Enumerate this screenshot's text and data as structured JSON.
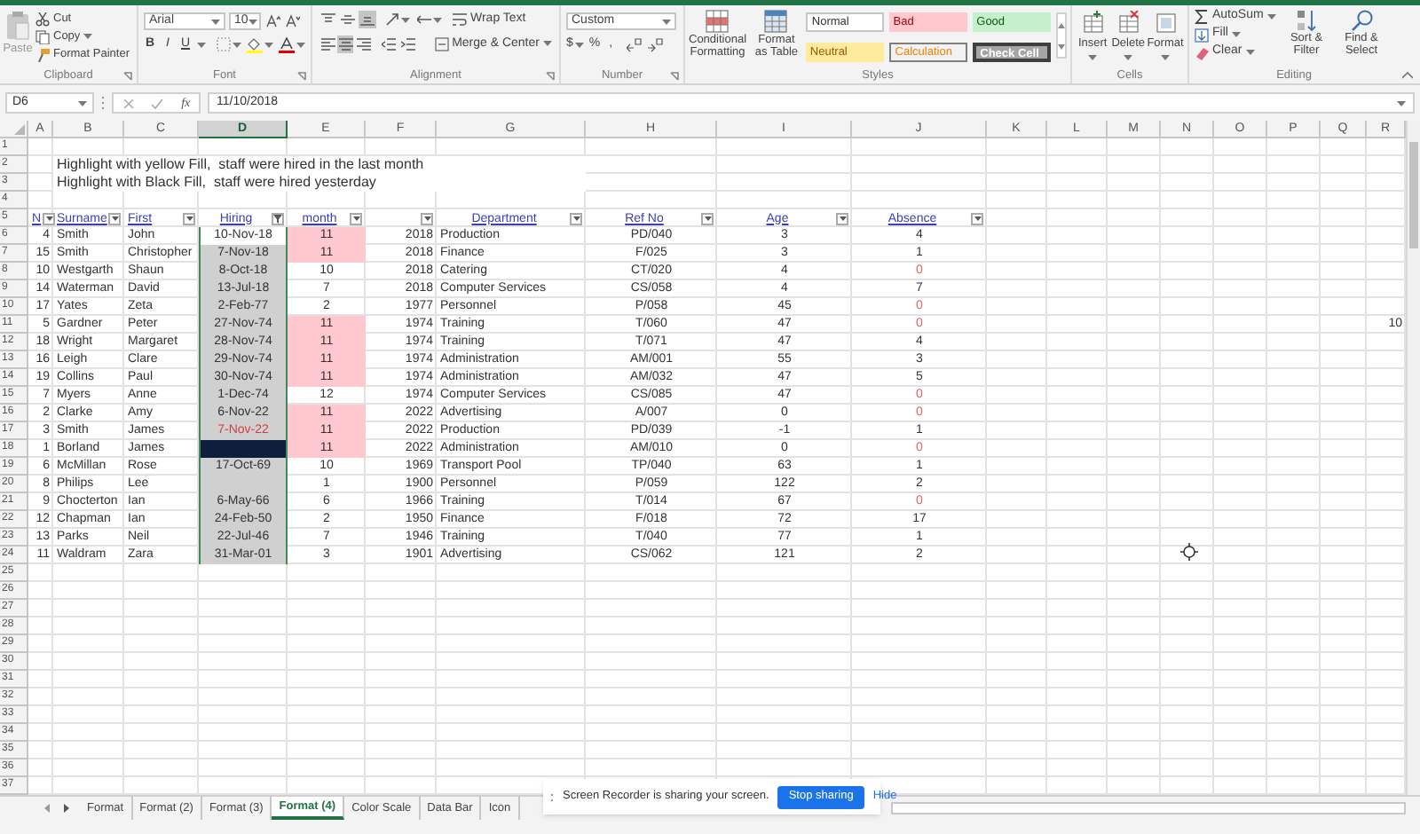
{
  "ribbon": {
    "clipboard": {
      "label": "Clipboard",
      "paste": "Paste",
      "cut": "Cut",
      "copy": "Copy",
      "format_painter": "Format Painter"
    },
    "font": {
      "label": "Font",
      "name": "Arial",
      "size": "10",
      "bold": "B",
      "italic": "I",
      "underline": "U"
    },
    "alignment": {
      "label": "Alignment",
      "wrap": "Wrap Text",
      "merge": "Merge & Center",
      "vertical_align": [
        {
          "selected": false
        },
        {
          "selected": false
        },
        {
          "selected": true
        }
      ],
      "horizontal_align": [
        {
          "selected": false
        },
        {
          "selected": true
        },
        {
          "selected": false
        }
      ]
    },
    "number": {
      "label": "Number",
      "format": "Custom",
      "currency": "$",
      "percent": "%",
      "comma": ","
    },
    "styles": {
      "label": "Styles",
      "conditional": "Conditional Formatting",
      "format_table": "Format as Table",
      "gallery": [
        {
          "label": "Normal",
          "kind": "normal"
        },
        {
          "label": "Bad",
          "kind": "bad"
        },
        {
          "label": "Good",
          "kind": "good"
        },
        {
          "label": "Neutral",
          "kind": "neutral"
        },
        {
          "label": "Calculation",
          "kind": "calculation"
        },
        {
          "label": "Check Cell",
          "kind": "check"
        }
      ]
    },
    "cells": {
      "label": "Cells",
      "buttons": [
        "Insert",
        "Delete",
        "Format"
      ]
    },
    "editing": {
      "label": "Editing",
      "autosum": "AutoSum",
      "fill": "Fill",
      "clear": "Clear",
      "sort": "Sort & Filter",
      "find": "Find & Select"
    }
  },
  "formula_bar": {
    "name_box": "D6",
    "function_label": "fx",
    "formula": "11/10/2018"
  },
  "columns": [
    {
      "letter": "A",
      "selected": false
    },
    {
      "letter": "B",
      "selected": false
    },
    {
      "letter": "C",
      "selected": false
    },
    {
      "letter": "D",
      "selected": true
    },
    {
      "letter": "E",
      "selected": false
    },
    {
      "letter": "F",
      "selected": false
    },
    {
      "letter": "G",
      "selected": false
    },
    {
      "letter": "H",
      "selected": false
    },
    {
      "letter": "I",
      "selected": false
    },
    {
      "letter": "J",
      "selected": false
    },
    {
      "letter": "K",
      "selected": false
    },
    {
      "letter": "L",
      "selected": false
    },
    {
      "letter": "M",
      "selected": false
    },
    {
      "letter": "N",
      "selected": false
    },
    {
      "letter": "O",
      "selected": false
    },
    {
      "letter": "P",
      "selected": false
    },
    {
      "letter": "Q",
      "selected": false
    },
    {
      "letter": "R",
      "selected": false
    }
  ],
  "row_numbers": [
    "1",
    "2",
    "3",
    "4",
    "5",
    "6",
    "7",
    "8",
    "9",
    "10",
    "11",
    "12",
    "13",
    "14",
    "15",
    "16",
    "17",
    "18",
    "19",
    "20",
    "21",
    "22",
    "23",
    "24",
    "25",
    "26",
    "27",
    "28",
    "29",
    "30",
    "31",
    "32",
    "33",
    "34",
    "35",
    "36",
    "37"
  ],
  "notes": [
    "Highlight with yellow Fill,  staff were hired in the last month",
    "Highlight with Black Fill,  staff were hired yesterday"
  ],
  "table": {
    "headers": [
      {
        "label": "N",
        "filtered": false
      },
      {
        "label": "Surname",
        "filtered": false
      },
      {
        "label": "First",
        "filtered": false
      },
      {
        "label": "Hiring",
        "filtered": true
      },
      {
        "label": "month",
        "filtered": false
      },
      {
        "filtered": false
      },
      {
        "label": "Department",
        "filtered": false
      },
      {
        "label": "Ref No",
        "filtered": false
      },
      {
        "label": "Age",
        "filtered": false
      },
      {
        "label": "Absence",
        "filtered": false
      }
    ],
    "rows": [
      {
        "no": "4",
        "surname": "Smith",
        "first": "John",
        "hiring": "10-Nov-18",
        "selected": false,
        "dark": false,
        "hiring_red": false,
        "month": "11",
        "month_pink": true,
        "year": "2018",
        "department": "Production",
        "ref": "PD/040",
        "age": "3",
        "absence": "4",
        "absence_red": false
      },
      {
        "no": "15",
        "surname": "Smith",
        "first": "Christopher",
        "hiring": "7-Nov-18",
        "selected": true,
        "dark": false,
        "hiring_red": false,
        "month": "11",
        "month_pink": true,
        "year": "2018",
        "department": "Finance",
        "ref": "F/025",
        "age": "3",
        "absence": "1",
        "absence_red": false
      },
      {
        "no": "10",
        "surname": "Westgarth",
        "first": "Shaun",
        "hiring": "8-Oct-18",
        "selected": true,
        "dark": false,
        "hiring_red": false,
        "month": "10",
        "month_pink": false,
        "year": "2018",
        "department": "Catering",
        "ref": "CT/020",
        "age": "4",
        "absence": "0",
        "absence_red": true
      },
      {
        "no": "14",
        "surname": "Waterman",
        "first": "David",
        "hiring": "13-Jul-18",
        "selected": true,
        "dark": false,
        "hiring_red": false,
        "month": "7",
        "month_pink": false,
        "year": "2018",
        "department": "Computer Services",
        "ref": "CS/058",
        "age": "4",
        "absence": "7",
        "absence_red": false
      },
      {
        "no": "17",
        "surname": "Yates",
        "first": "Zeta",
        "hiring": "2-Feb-77",
        "selected": true,
        "dark": false,
        "hiring_red": false,
        "month": "2",
        "month_pink": false,
        "year": "1977",
        "department": "Personnel",
        "ref": "P/058",
        "age": "45",
        "absence": "0",
        "absence_red": true
      },
      {
        "no": "5",
        "surname": "Gardner",
        "first": "Peter",
        "hiring": "27-Nov-74",
        "selected": true,
        "dark": false,
        "hiring_red": false,
        "month": "11",
        "month_pink": true,
        "year": "1974",
        "department": "Training",
        "ref": "T/060",
        "age": "47",
        "absence": "0",
        "absence_red": true,
        "column_r": "10"
      },
      {
        "no": "18",
        "surname": "Wright",
        "first": "Margaret",
        "hiring": "28-Nov-74",
        "selected": true,
        "dark": false,
        "hiring_red": false,
        "month": "11",
        "month_pink": true,
        "year": "1974",
        "department": "Training",
        "ref": "T/071",
        "age": "47",
        "absence": "4",
        "absence_red": false
      },
      {
        "no": "16",
        "surname": "Leigh",
        "first": "Clare",
        "hiring": "29-Nov-74",
        "selected": true,
        "dark": false,
        "hiring_red": false,
        "month": "11",
        "month_pink": true,
        "year": "1974",
        "department": "Administration",
        "ref": "AM/001",
        "age": "55",
        "absence": "3",
        "absence_red": false
      },
      {
        "no": "19",
        "surname": "Collins",
        "first": "Paul",
        "hiring": "30-Nov-74",
        "selected": true,
        "dark": false,
        "hiring_red": false,
        "month": "11",
        "month_pink": true,
        "year": "1974",
        "department": "Administration",
        "ref": "AM/032",
        "age": "47",
        "absence": "5",
        "absence_red": false
      },
      {
        "no": "7",
        "surname": "Myers",
        "first": "Anne",
        "hiring": "1-Dec-74",
        "selected": true,
        "dark": false,
        "hiring_red": false,
        "month": "12",
        "month_pink": false,
        "year": "1974",
        "department": "Computer Services",
        "ref": "CS/085",
        "age": "47",
        "absence": "0",
        "absence_red": true
      },
      {
        "no": "2",
        "surname": "Clarke",
        "first": "Amy",
        "hiring": "6-Nov-22",
        "selected": true,
        "dark": false,
        "hiring_red": false,
        "month": "11",
        "month_pink": true,
        "year": "2022",
        "department": "Advertising",
        "ref": "A/007",
        "age": "0",
        "absence": "0",
        "absence_red": true
      },
      {
        "no": "3",
        "surname": "Smith",
        "first": "James",
        "hiring": "7-Nov-22",
        "selected": true,
        "dark": false,
        "hiring_red": true,
        "month": "11",
        "month_pink": true,
        "year": "2022",
        "department": "Production",
        "ref": "PD/039",
        "age": "-1",
        "absence": "1",
        "absence_red": false
      },
      {
        "no": "1",
        "surname": "Borland",
        "first": "James",
        "dark": true,
        "month": "11",
        "month_pink": true,
        "year": "2022",
        "department": "Administration",
        "ref": "AM/010",
        "age": "0",
        "absence": "0",
        "absence_red": true
      },
      {
        "no": "6",
        "surname": "McMillan",
        "first": "Rose",
        "hiring": "17-Oct-69",
        "selected": true,
        "dark": false,
        "hiring_red": false,
        "month": "10",
        "month_pink": false,
        "year": "1969",
        "department": "Transport Pool",
        "ref": "TP/040",
        "age": "63",
        "absence": "1",
        "absence_red": false
      },
      {
        "no": "8",
        "surname": "Philips",
        "first": "Lee",
        "selected": true,
        "dark": false,
        "month": "1",
        "month_pink": false,
        "year": "1900",
        "department": "Personnel",
        "ref": "P/059",
        "age": "122",
        "absence": "2",
        "absence_red": false
      },
      {
        "no": "9",
        "surname": "Chocterton",
        "first": "Ian",
        "hiring": "6-May-66",
        "selected": true,
        "dark": false,
        "hiring_red": false,
        "month": "6",
        "month_pink": false,
        "year": "1966",
        "department": "Training",
        "ref": "T/014",
        "age": "67",
        "absence": "0",
        "absence_red": true
      },
      {
        "no": "12",
        "surname": "Chapman",
        "first": "Ian",
        "hiring": "24-Feb-50",
        "selected": true,
        "dark": false,
        "hiring_red": false,
        "month": "2",
        "month_pink": false,
        "year": "1950",
        "department": "Finance",
        "ref": "F/018",
        "age": "72",
        "absence": "17",
        "absence_red": false
      },
      {
        "no": "13",
        "surname": "Parks",
        "first": "Neil",
        "hiring": "22-Jul-46",
        "selected": true,
        "dark": false,
        "hiring_red": false,
        "month": "7",
        "month_pink": false,
        "year": "1946",
        "department": "Training",
        "ref": "T/040",
        "age": "77",
        "absence": "1",
        "absence_red": false
      },
      {
        "no": "11",
        "surname": "Waldram",
        "first": "Zara",
        "hiring": "31-Mar-01",
        "selected": true,
        "dark": false,
        "hiring_red": false,
        "month": "3",
        "month_pink": false,
        "year": "1901",
        "department": "Advertising",
        "ref": "CS/062",
        "age": "121",
        "absence": "2",
        "absence_red": false
      }
    ]
  },
  "sheet_tabs": [
    {
      "label": "Format",
      "selected": false
    },
    {
      "label": "Format (2)",
      "selected": false
    },
    {
      "label": "Format (3)",
      "selected": false
    },
    {
      "label": "Format (4)",
      "selected": true
    },
    {
      "label": "Color Scale",
      "selected": false
    },
    {
      "label": "Data Bar",
      "selected": false
    },
    {
      "label": "Icon",
      "selected": false
    }
  ],
  "share_bar": {
    "message": "Screen Recorder is sharing your screen.",
    "stop_button": "Stop sharing",
    "hide_link": "Hide"
  }
}
